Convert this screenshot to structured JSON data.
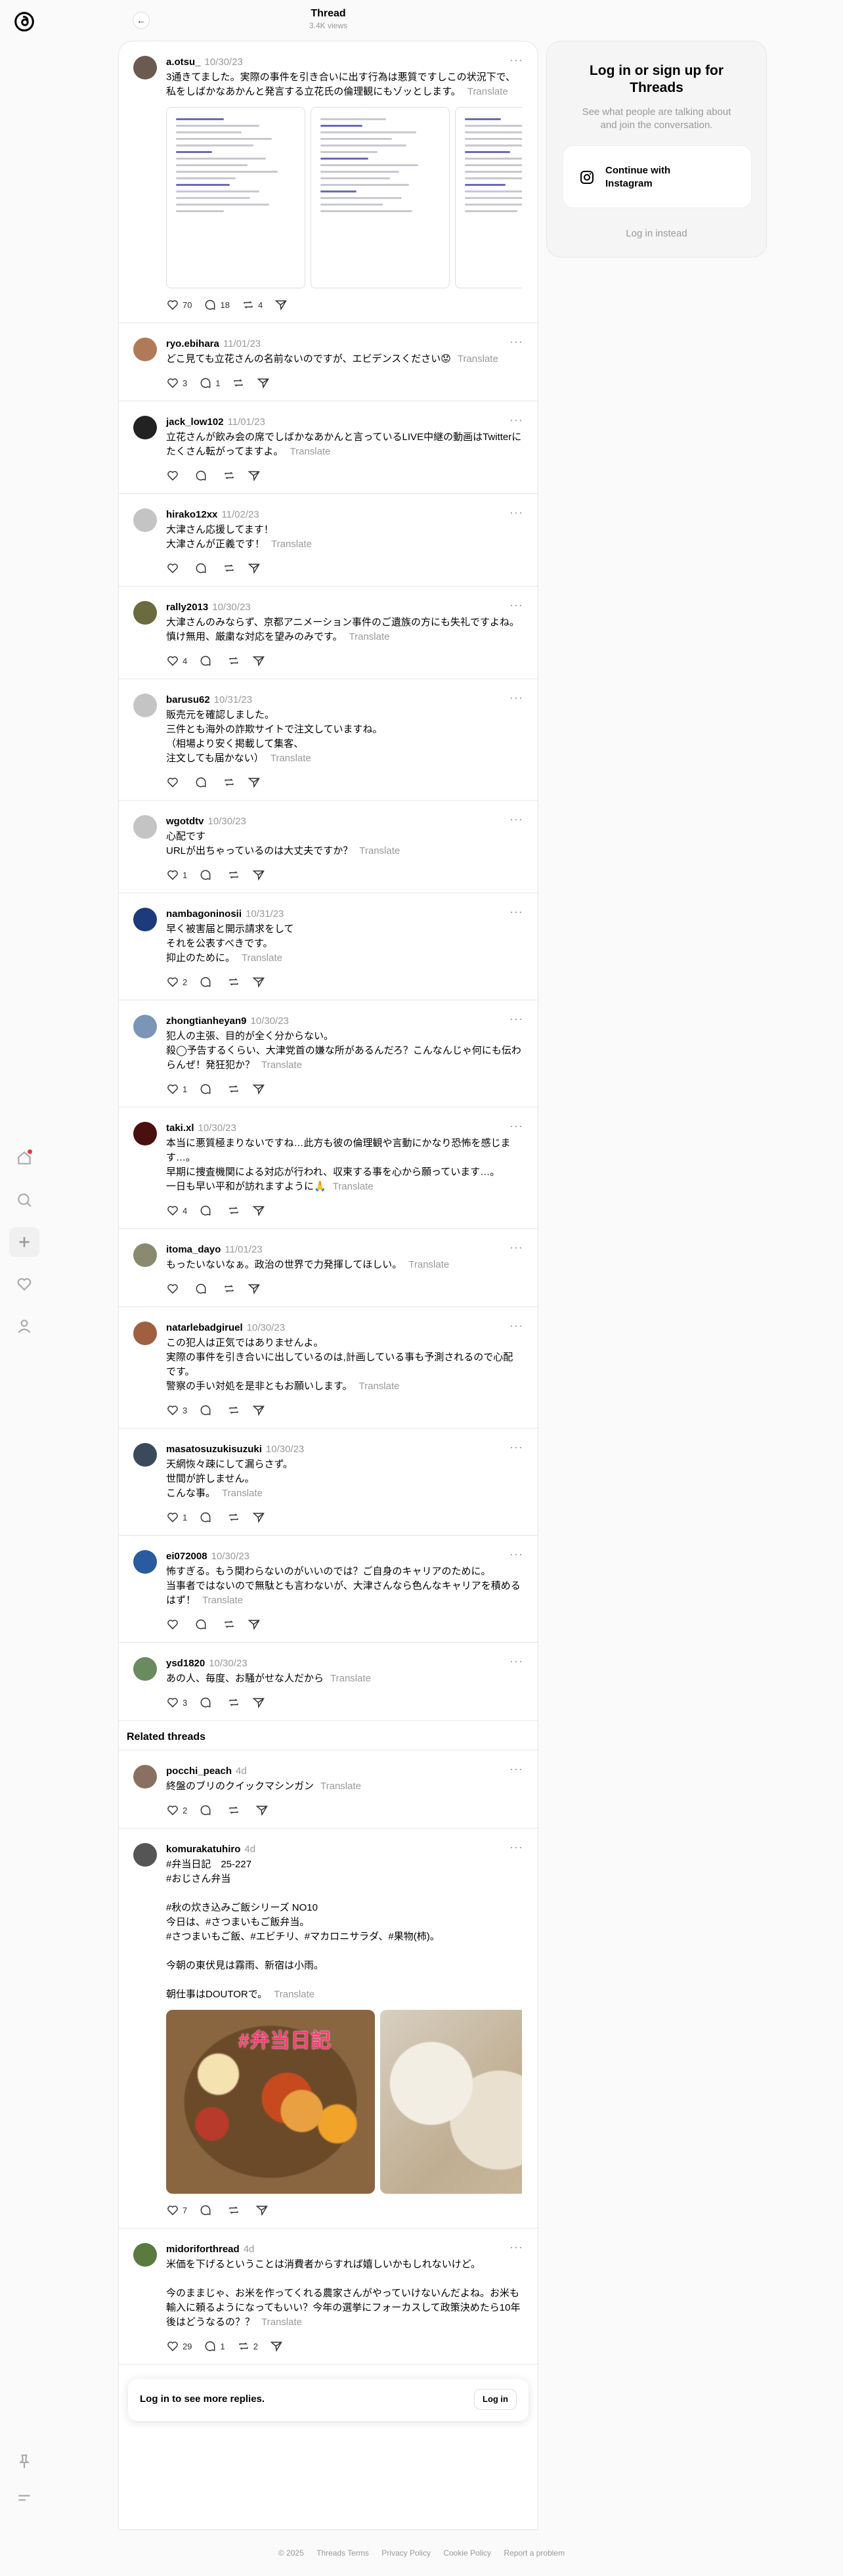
{
  "header": {
    "title": "Thread",
    "views": "3.4K views"
  },
  "card": {
    "title": "Log in or sign up for Threads",
    "subtitle": "See what people are talking about and join the conversation.",
    "instagram_button": "Continue with Instagram",
    "username_link": "Log in instead"
  },
  "translate_label": "Translate",
  "main_post": {
    "user": "a.otsu_",
    "time": "10/30/23",
    "text": "3通きてました。実際の事件を引き合いに出す行為は悪質ですしこの状況下で、私をしばかなあかんと発言する立花氏の倫理観にもゾッとします。",
    "likes": "70",
    "replies": "18",
    "reposts": "4"
  },
  "replies": [
    {
      "user": "ryo.ebihara",
      "time": "11/01/23",
      "text": "どこ見ても立花さんの名前ないのですが、エビデンスください😟",
      "likes": "3",
      "replies": "1",
      "avatar": "#b07a58"
    },
    {
      "user": "jack_low102",
      "time": "11/01/23",
      "text": "立花さんが飲み会の席でしばかなあかんと言っているLIVE中継の動画はTwitterにたくさん転がってますよ。",
      "likes": "",
      "replies": "",
      "avatar": "#222222"
    },
    {
      "user": "hirako12xx",
      "time": "11/02/23",
      "text": "大津さん応援してます！\n大津さんが正義です！",
      "likes": "",
      "replies": "",
      "avatar": "#c4c4c4"
    },
    {
      "user": "rally2013",
      "time": "10/30/23",
      "text": "大津さんのみならず、京都アニメーション事件のご遺族の方にも失礼ですよね。\n慎け無用、厳粛な対応を望みのみです。",
      "likes": "4",
      "replies": "",
      "avatar": "#6b6b40"
    },
    {
      "user": "barusu62",
      "time": "10/31/23",
      "text": "販売元を確認しました。\n三件とも海外の詐欺サイトで注文していますね。\n（相場より安く掲載して集客、\n注文しても届かない）",
      "likes": "",
      "replies": "",
      "avatar": "#c4c4c4"
    },
    {
      "user": "wgotdtv",
      "time": "10/30/23",
      "text": "心配です\nURLが出ちゃっているのは大丈夫ですか？",
      "likes": "1",
      "replies": "",
      "avatar": "#c4c4c4"
    },
    {
      "user": "nambagoninosii",
      "time": "10/31/23",
      "text": "早く被害届と開示請求をして\nそれを公表すべきです。\n抑止のために。",
      "likes": "2",
      "replies": "",
      "avatar": "#1d3a7a"
    },
    {
      "user": "zhongtianheyan9",
      "time": "10/30/23",
      "text": "犯人の主張、目的が全く分からない。\n殺◯予告するくらい、大津党首の嫌な所があるんだろ？こんなんじゃ何にも伝わらんぜ！発狂犯か？",
      "likes": "1",
      "replies": "",
      "avatar": "#7a95b5"
    },
    {
      "user": "taki.xl",
      "time": "10/30/23",
      "text": "本当に悪質極まりないですね…此方も彼の倫理観や言動にかなり恐怖を感じます…。\n早期に捜査機関による対応が行われ、収束する事を心から願っています…。\n一日も早い平和が訪れますように🙏",
      "likes": "4",
      "replies": "",
      "avatar": "#4a1010"
    },
    {
      "user": "itoma_dayo",
      "time": "11/01/23",
      "text": "もったいないなぁ。政治の世界で力発揮してほしい。",
      "likes": "",
      "replies": "",
      "avatar": "#8a8a70"
    },
    {
      "user": "natarlebadgiruel",
      "time": "10/30/23",
      "text": "この犯人は正気ではありませんよ。\n実際の事件を引き合いに出しているのは,計画している事も予測されるので心配です。\n警察の手い対処を是非ともお願いします。",
      "likes": "3",
      "replies": "",
      "avatar": "#a06040"
    },
    {
      "user": "masatosuzukisuzuki",
      "time": "10/30/23",
      "text": "天網恢々疎にして漏らさず。\n世間が許しません。\nこんな事。",
      "likes": "1",
      "replies": "",
      "avatar": "#3a4a5a"
    },
    {
      "user": "ei072008",
      "time": "10/30/23",
      "text": "怖すぎる。もう関わらないのがいいのでは？ご自身のキャリアのために。\n当事者ではないので無駄とも言わないが、大津さんなら色んなキャリアを積めるはず！",
      "likes": "",
      "replies": "",
      "avatar": "#2a5aa0"
    },
    {
      "user": "ysd1820",
      "time": "10/30/23",
      "text": "あの人、毎度、お騒がせな人だから",
      "likes": "3",
      "replies": "",
      "avatar": "#6a8a60"
    }
  ],
  "related_title": "Related threads",
  "related": [
    {
      "user": "pocchi_peach",
      "time": "4d",
      "text": "終盤のブリのクイックマシンガン",
      "likes": "2",
      "replies": "",
      "reposts": "",
      "avatar": "#8a7060"
    },
    {
      "user": "komurakatuhiro",
      "time": "4d",
      "text": "#弁当日記　25-227\n#おじさん弁当\n\n#秋の炊き込みご飯シリーズ NO10\n今日は、#さつまいもご飯弁当。\n#さつまいもご飯、#エビチリ、#マカロニサラダ、#果物(柿)。\n\n今朝の東伏見は霧雨、新宿は小雨。\n\n朝仕事はDOUTORで。",
      "likes": "7",
      "replies": "",
      "reposts": "",
      "avatar": "#555555",
      "image_caption": "#弁当日記"
    },
    {
      "user": "midoriforthread",
      "time": "4d",
      "text": "米価を下げるということは消費者からすれば嬉しいかもしれないけど。\n\n今のままじゃ、お米を作ってくれる農家さんがやっていけないんだよね。お米も輸入に頼るようになってもいい？今年の選挙にフォーカスして政策決めたら10年後はどうなるの？？",
      "likes": "29",
      "replies": "1",
      "reposts": "2",
      "avatar": "#5a7a40"
    }
  ],
  "login_bar": {
    "text": "Log in to see more replies.",
    "button": "Log in"
  },
  "footer": {
    "copyright": "© 2025",
    "links": [
      "Threads Terms",
      "Privacy Policy",
      "Cookie Policy",
      "Report a problem"
    ]
  }
}
